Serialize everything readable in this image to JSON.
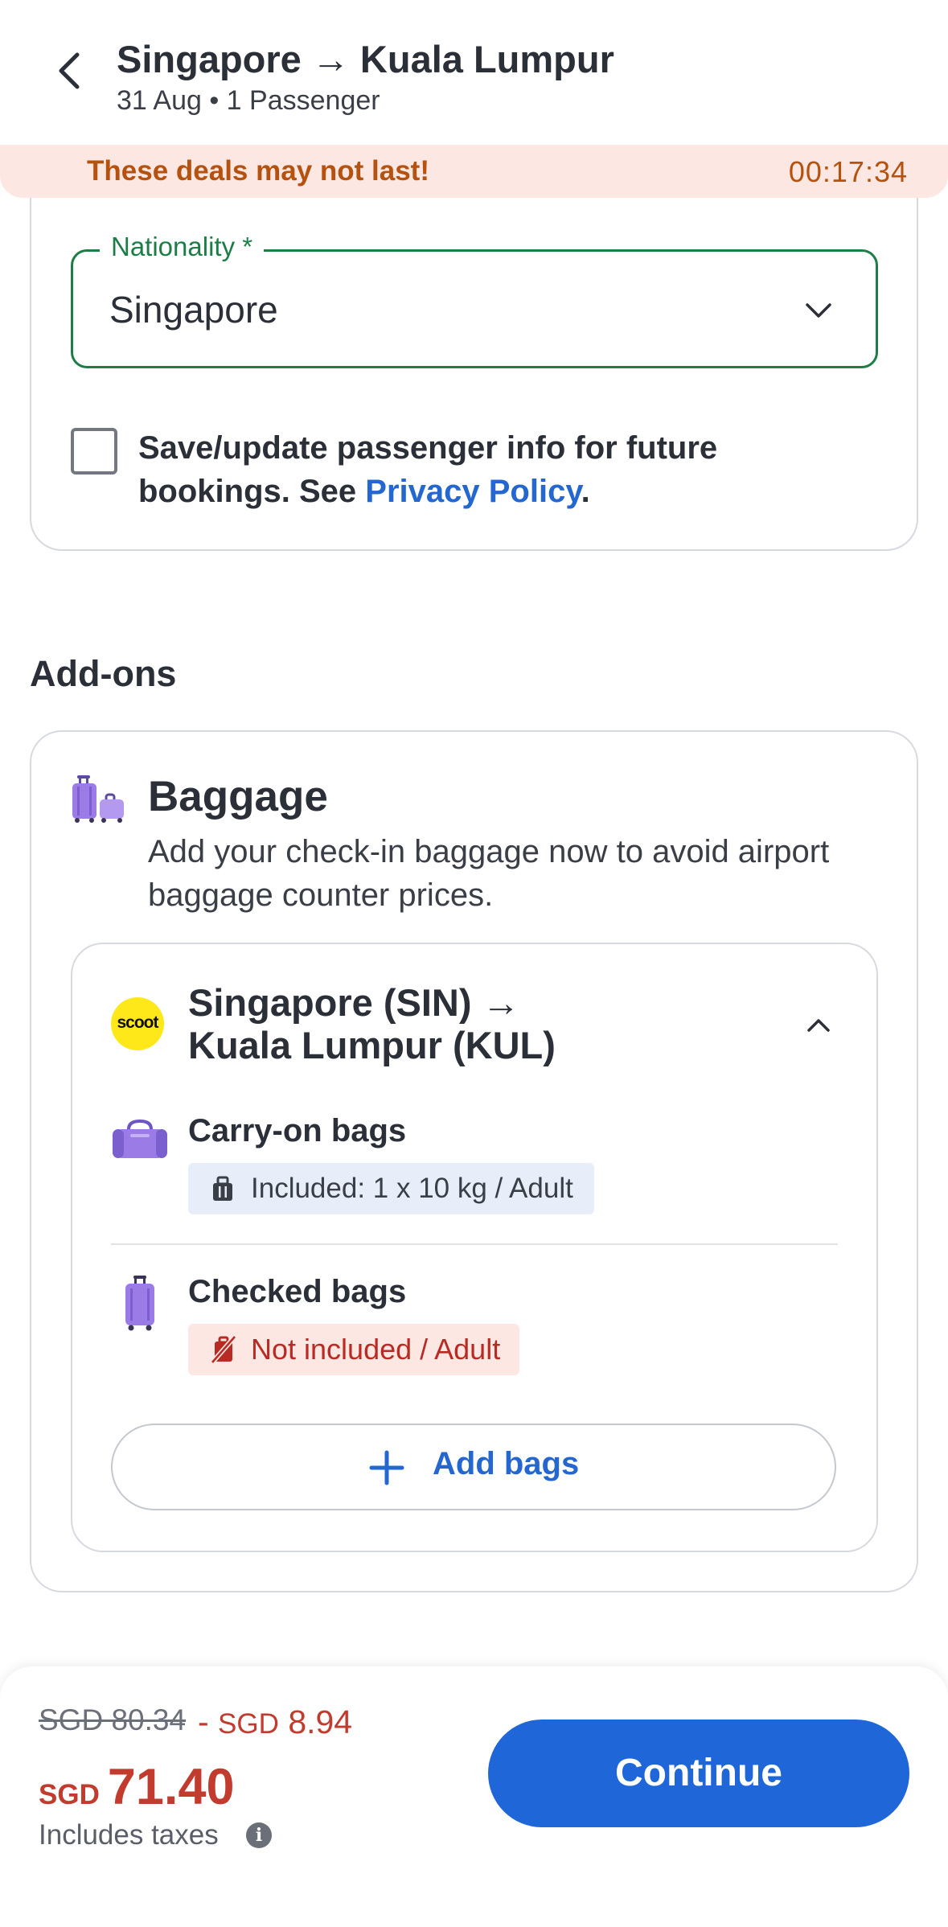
{
  "header": {
    "title": "Singapore → Kuala Lumpur",
    "subtitle": "31 Aug • 1 Passenger"
  },
  "deal_banner": {
    "text": "These deals may not last!",
    "timer": "00:17:34"
  },
  "passenger_form": {
    "nationality_label": "Nationality *",
    "nationality_value": "Singapore",
    "save_info_text": "Save/update passenger info for future bookings. See ",
    "privacy_link": "Privacy Policy",
    "save_info_suffix": ".",
    "save_checked": false
  },
  "addons": {
    "heading": "Add-ons",
    "baggage": {
      "title": "Baggage",
      "description": "Add your check-in baggage now to avoid airport baggage counter prices.",
      "flight": {
        "airline_logo_text": "scoot",
        "route_line1": "Singapore (SIN) →",
        "route_line2": "Kuala Lumpur (KUL)"
      },
      "carry_on": {
        "title": "Carry-on bags",
        "badge": "Included: 1 x 10 kg / Adult"
      },
      "checked": {
        "title": "Checked bags",
        "badge": "Not included / Adult"
      },
      "add_button": "Add bags"
    }
  },
  "footer": {
    "original_price": "SGD 80.34",
    "discount_prefix": "- ",
    "discount_currency": "SGD",
    "discount_amount": "8.94",
    "final_currency": "SGD",
    "final_amount": "71.40",
    "taxes_note": "Includes taxes",
    "continue_label": "Continue"
  },
  "colors": {
    "primary_blue": "#1f66d9",
    "success_green": "#1d7d47",
    "deal_orange": "#b5520f",
    "price_red": "#c23b2f",
    "airline_yellow": "#ffe81a",
    "luggage_purple": "#9b7be6"
  }
}
